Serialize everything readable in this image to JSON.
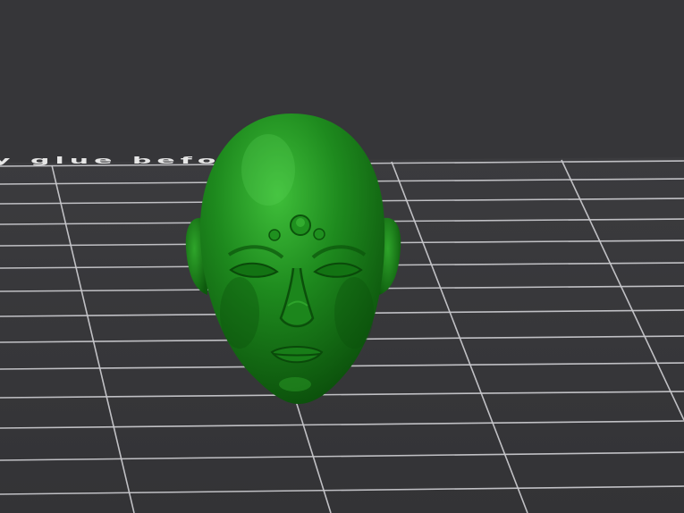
{
  "viewport": {
    "background_color": "#363639",
    "bed_color": "#3a3a3d",
    "grid_color": "#c8c8cc",
    "bed_label": "y glue before prin"
  },
  "model": {
    "color": "#1e8a1e",
    "highlight_color": "#3fbf3a",
    "shadow_color": "#0b4f0b"
  }
}
